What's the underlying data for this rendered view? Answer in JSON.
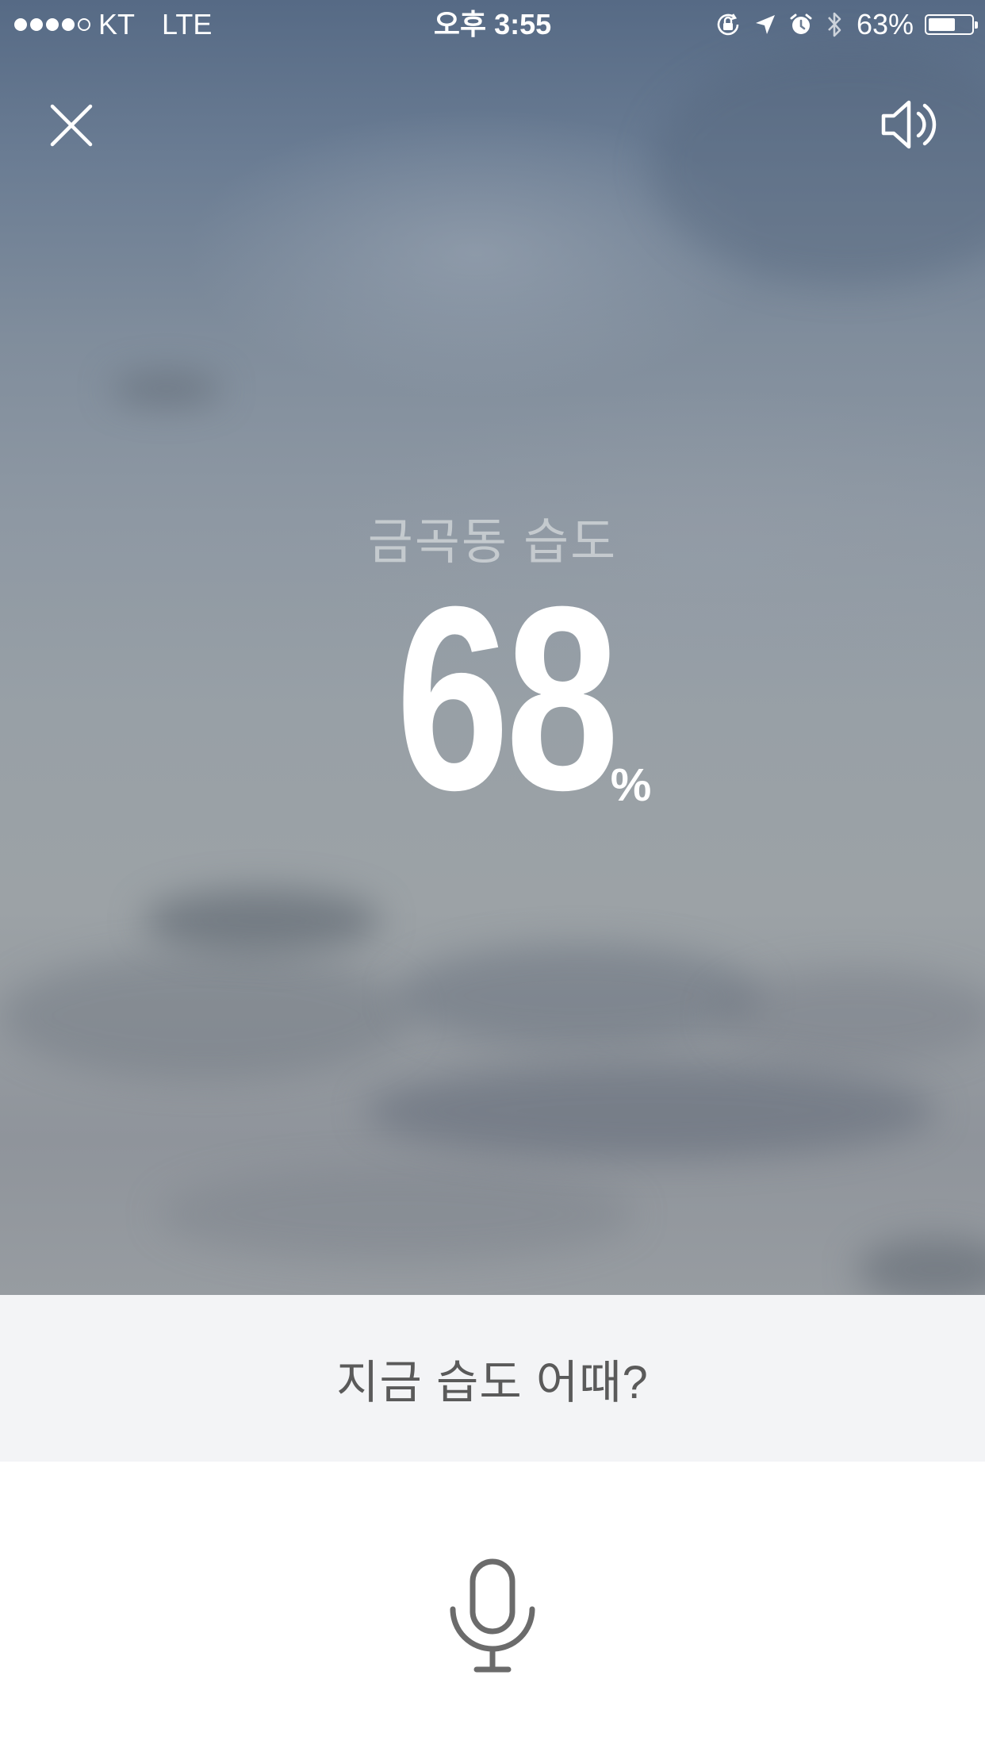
{
  "status_bar": {
    "signal_dots_filled": 4,
    "signal_dots_total": 5,
    "carrier": "KT",
    "network": "LTE",
    "time": "오후 3:55",
    "battery_percent": "63%",
    "battery_level": 0.63,
    "icons": [
      "orientation-lock-icon",
      "location-arrow-icon",
      "alarm-icon",
      "bluetooth-icon",
      "battery-icon"
    ]
  },
  "toolbar": {
    "close_icon": "close-icon",
    "sound_icon": "speaker-icon"
  },
  "weather": {
    "location_label": "금곡동 습도",
    "value": "68",
    "unit": "%"
  },
  "query": {
    "text": "지금 습도 어때?"
  },
  "voice": {
    "icon": "microphone-icon"
  },
  "colors": {
    "query_bar_bg": "#f3f4f6",
    "query_text": "#5a5a5a",
    "mic_icon": "#6b6b6b"
  }
}
